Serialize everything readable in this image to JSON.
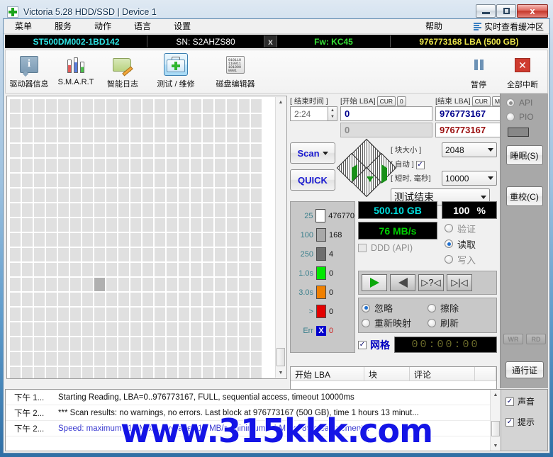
{
  "window": {
    "title": "Victoria 5.28 HDD/SSD | Device 1",
    "minimize": "—",
    "maximize": "□",
    "close": "x"
  },
  "menu": {
    "items": [
      "菜单",
      "服务",
      "动作",
      "语言",
      "设置"
    ],
    "help": "帮助",
    "buffer_view": "实时查看缓冲区"
  },
  "drive_bar": {
    "model": "ST500DM002-1BD142",
    "serial": "SN: S2AHZS80",
    "close": "x",
    "firmware": "Fw: KC45",
    "capacity": "976773168 LBA (500 GB)"
  },
  "toolbar": {
    "buttons": [
      {
        "label": "驱动器信息",
        "icon": "drive-info-icon"
      },
      {
        "label": "S.M.A.R.T",
        "icon": "smart-icon"
      },
      {
        "label": "智能日志",
        "icon": "smart-log-icon"
      },
      {
        "label": "测试 / 维修",
        "icon": "test-repair-icon"
      },
      {
        "label": "磁盘编辑器",
        "icon": "disk-editor-icon"
      }
    ],
    "pause": "暂停",
    "abort_all": "全部中断"
  },
  "scan": {
    "end_time_label": "[ 结束时间 ]",
    "end_time_value": "2:24",
    "start_lba_label": "[开始 LBA]",
    "start_lba_cur": "CUR",
    "start_lba_zero": "0",
    "start_lba_value": "0",
    "start_lba_secondary": "0",
    "end_lba_label": "[结束 LBA]",
    "end_lba_cur": "CUR",
    "end_lba_max": "MAX",
    "end_lba_value": "976773167",
    "end_lba_secondary": "976773167",
    "scan_button": "Scan",
    "quick_button": "QUICK",
    "block_size_label": "[ 块大小 ]",
    "auto_label": "[ 自动 ]",
    "auto_checked": "✓",
    "block_size_value": "2048",
    "timeout_label": "[ 短时, 毫秒]",
    "timeout_value": "10000",
    "status_select": "测试结束"
  },
  "stats": {
    "rows": [
      {
        "threshold": "25",
        "value": "476770",
        "color": "#ffffff"
      },
      {
        "threshold": "100",
        "value": "168",
        "color": "#a8a8a8"
      },
      {
        "threshold": "250",
        "value": "4",
        "color": "#6e6e6e"
      },
      {
        "threshold": "1.0s",
        "value": "0",
        "color": "#00e800"
      },
      {
        "threshold": "3.0s",
        "value": "0",
        "color": "#f08000"
      },
      {
        "threshold": ">",
        "value": "0",
        "color": "#e40000"
      }
    ],
    "err_label": "Err",
    "err_mark": "X",
    "err_value": "0"
  },
  "readout": {
    "capacity": "500.10 GB",
    "percent_value": "100",
    "percent_unit": "%",
    "speed": "76 MB/s",
    "ddd_api": "DDD (API)",
    "modes": [
      {
        "label": "验证",
        "selected": false,
        "disabled": true
      },
      {
        "label": "读取",
        "selected": true,
        "disabled": false
      },
      {
        "label": "写入",
        "selected": false,
        "disabled": true
      }
    ]
  },
  "transport": {
    "play": "play-icon",
    "reverse": "reverse-icon",
    "unknown": "▷?◁",
    "end": "▷|◁"
  },
  "defect_action": {
    "options": [
      {
        "label": "忽略",
        "selected": true
      },
      {
        "label": "擦除",
        "selected": false
      },
      {
        "label": "重新映射",
        "selected": false
      },
      {
        "label": "刷新",
        "selected": false
      }
    ]
  },
  "grid_toggle": {
    "checked": "✓",
    "label": "网格",
    "timer": "00:00:00"
  },
  "defect_table": {
    "headers": [
      "开始 LBA",
      "块",
      "评论",
      ""
    ]
  },
  "rail": {
    "api": "API",
    "pio": "PIO",
    "sleep": "睡眠(S)",
    "sleep_main": "睡眠(",
    "sleep_key": "S",
    "recal": "重校(C)",
    "recal_main": "重校(",
    "recal_key": "C",
    "wr": "WR",
    "rd": "RD",
    "pass": "通行证"
  },
  "log": {
    "rows": [
      {
        "time": "下午 1...",
        "message": "Starting Reading, LBA=0..976773167, FULL, sequential access, timeout 10000ms",
        "blue": false
      },
      {
        "time": "下午 2...",
        "message": "*** Scan results: no warnings, no errors. Last block at 976773167 (500 GB), time 1 hours 13 minut...",
        "blue": false
      },
      {
        "time": "下午 2...",
        "message": "Speed: maximum 119 MB/s, average 110 MB/s, minimum 14 MB/s, 89 measurements.",
        "blue": true
      }
    ],
    "sound_label": "声音",
    "sound_checked": "✓",
    "tips_label": "提示",
    "tips_checked": "✓"
  },
  "watermark": "www.315kkk.com",
  "colors": {
    "accent_cyan": "#2ee6e6",
    "accent_green": "#35e035",
    "accent_yellow": "#e8e34a",
    "lcd_speed": "#00d000",
    "radio_blue": "#1d6fd0",
    "watermark_blue": "#1414e6"
  }
}
